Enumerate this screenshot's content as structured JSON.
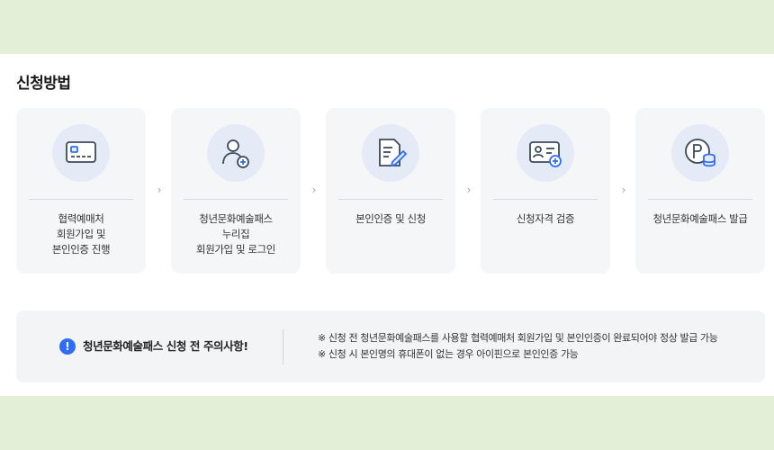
{
  "section": {
    "title": "신청방법"
  },
  "steps": [
    {
      "icon": "credit-card-icon",
      "label": "협력예매처\n회원가입 및\n본인인증 진행"
    },
    {
      "icon": "user-add-icon",
      "label": "청년문화예술패스\n누리집\n회원가입 및 로그인"
    },
    {
      "icon": "document-edit-icon",
      "label": "본인인증 및 신청"
    },
    {
      "icon": "id-card-add-icon",
      "label": "신청자격 검증"
    },
    {
      "icon": "point-coins-icon",
      "label": "청년문화예술패스 발급"
    }
  ],
  "notice": {
    "title": "청년문화예술패스 신청 전 주의사항!",
    "lines": [
      "※ 신청 전 청년문화예술패스를 사용할 협력예매처 회원가입 및 본인인증이 완료되어야 정상 발급 가능",
      "※ 신청 시 본인명의 휴대폰이 없는 경우 아이핀으로 본인인증 가능"
    ]
  },
  "colors": {
    "page_bg": "#e3efd7",
    "accent": "#2f6df6",
    "icon_bg": "#e4ebf7",
    "icon_stroke": "#3c4a5c"
  }
}
